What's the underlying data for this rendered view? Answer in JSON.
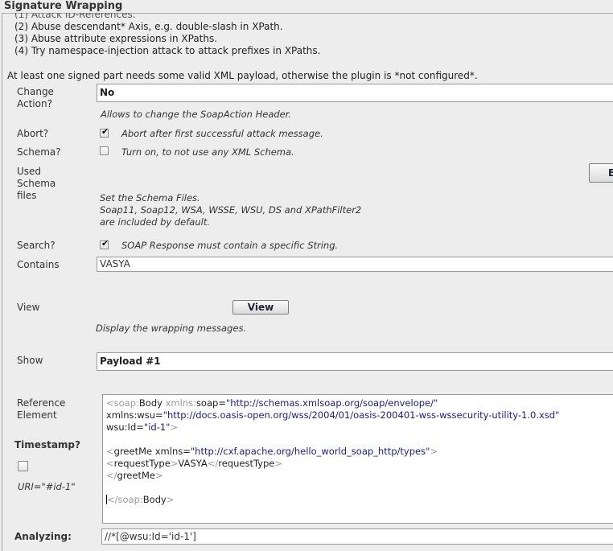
{
  "panel": {
    "title": "Signature Wrapping",
    "desc_lines": [
      "(2) Abuse descendant* Axis, e.g. double-slash in XPath.",
      "(3) Abuse attribute expressions in XPaths.",
      "(4) Try namespace-injection attack to attack prefixes in XPaths."
    ],
    "note": "At least one signed part needs some valid XML payload, otherwise the plugin is *not configured*."
  },
  "change_action": {
    "label_line1": "Change",
    "label_line2": "Action?",
    "value": "No",
    "hint": "Allows to change the SoapAction Header."
  },
  "abort": {
    "label": "Abort?",
    "checked": true,
    "text": "Abort after first successful attack message."
  },
  "schema": {
    "label": "Schema?",
    "checked": false,
    "text": "Turn on, to not use any XML Schema."
  },
  "schema_files": {
    "label_line1": "Used",
    "label_line2": "Schema",
    "label_line3": "files",
    "button_glyph": "E",
    "hint_line1": "Set the Schema Files.",
    "hint_line2": "Soap11, Soap12, WSA, WSSE, WSU, DS and XPathFilter2",
    "hint_line3": "are included by default."
  },
  "search": {
    "label": "Search?",
    "checked": true,
    "text": "SOAP Response must contain a specific String."
  },
  "contains": {
    "label": "Contains",
    "value": "VASYA"
  },
  "view": {
    "label": "View",
    "button": "View",
    "hint": "Display the wrapping messages."
  },
  "show": {
    "label": "Show",
    "value": "Payload #1"
  },
  "reference": {
    "label_line1": "Reference",
    "label_line2": "Element",
    "timestamp_label": "Timestamp?",
    "timestamp_checked": false,
    "uri": "URI=\"#id-1\""
  },
  "xml": {
    "l1_lt": "<",
    "l1_ns": "soap:",
    "l1_tag": "Body ",
    "l1_attr1": "xmlns:",
    "l1_attr2": "soap",
    "l1_eq": "=",
    "l1_val": "\"http://schemas.xmlsoap.org/soap/envelope/\"",
    "l2_attr": "xmlns:wsu",
    "l2_eq": "=",
    "l2_val": "\"http://docs.oasis-open.org/wss/2004/01/oasis-200401-wss-wssecurity-utility-1.0.xsd\"",
    "l3_attr": "wsu:Id",
    "l3_eq": "=",
    "l3_val": "\"id-1\"",
    "l3_gt": ">",
    "l5_lt": "<",
    "l5_tag": "greetMe ",
    "l5_attr": "xmlns",
    "l5_eq": "=",
    "l5_val": "\"http://cxf.apache.org/hello_world_soap_http/types\"",
    "l5_gt": ">",
    "l6_lt": "<",
    "l6_tag": "requestType",
    "l6_gt": ">",
    "l6_text": "VASYA",
    "l6_close_lt": "</",
    "l6_close_tag": "requestType",
    "l6_close_gt": ">",
    "l7_lt": "</",
    "l7_tag": "greetMe",
    "l7_gt": ">",
    "l9_lt": "</",
    "l9_ns": "soap:",
    "l9_tag": "Body",
    "l9_gt": ">"
  },
  "analyzing": {
    "label": "Analyzing:",
    "value": "//*[@wsu:Id='id-1']"
  }
}
